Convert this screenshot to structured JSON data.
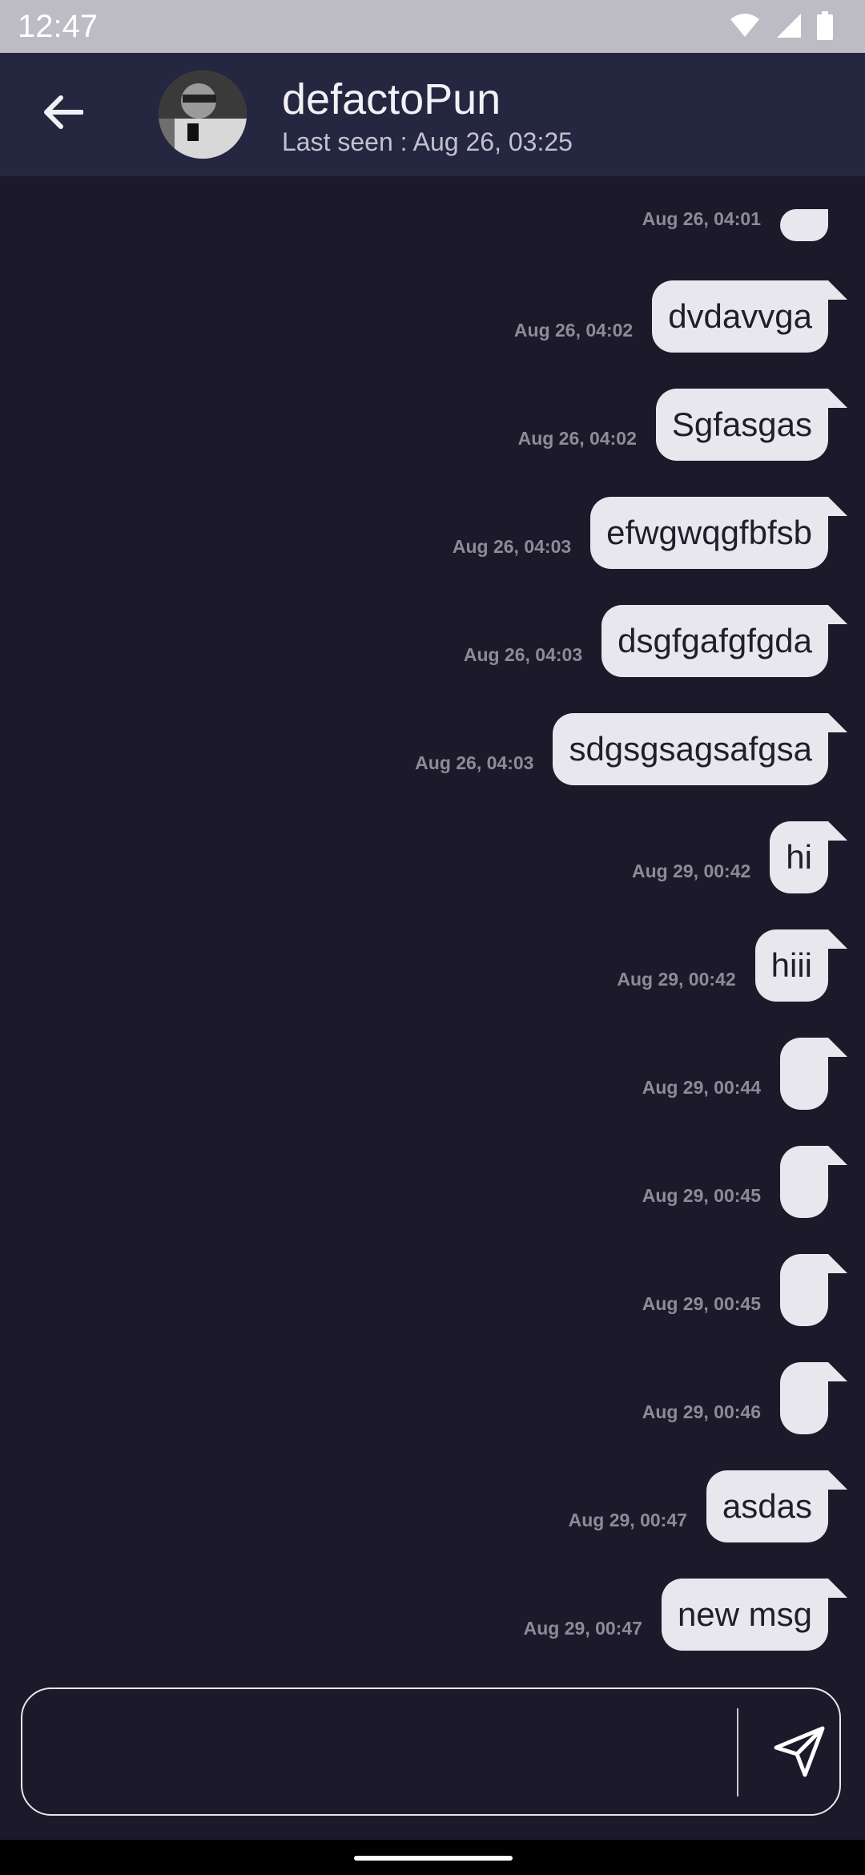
{
  "status_bar": {
    "time": "12:47",
    "icons": [
      "wifi-icon",
      "signal-icon",
      "battery-icon"
    ]
  },
  "header": {
    "contact_name": "defactoPun",
    "last_seen": "Last seen : Aug 26, 03:25",
    "avatar_alt": "avatar",
    "colors": {
      "header_bg": "#252640"
    }
  },
  "messages": [
    {
      "text": "",
      "time": "Aug 26, 04:01"
    },
    {
      "text": "dvdavvga",
      "time": "Aug 26, 04:02"
    },
    {
      "text": "Sgfasgas",
      "time": "Aug 26, 04:02"
    },
    {
      "text": "efwgwqgfbfsb",
      "time": "Aug 26, 04:03"
    },
    {
      "text": "dsgfgafgfgda",
      "time": "Aug 26, 04:03"
    },
    {
      "text": "sdgsgsagsafgsa",
      "time": "Aug 26, 04:03"
    },
    {
      "text": "hi",
      "time": "Aug 29, 00:42"
    },
    {
      "text": "hiii",
      "time": "Aug 29, 00:42"
    },
    {
      "text": "",
      "time": "Aug 29, 00:44"
    },
    {
      "text": "",
      "time": "Aug 29, 00:45"
    },
    {
      "text": "",
      "time": "Aug 29, 00:45"
    },
    {
      "text": "",
      "time": "Aug 29, 00:46"
    },
    {
      "text": "asdas",
      "time": "Aug 29, 00:47"
    },
    {
      "text": "new msg",
      "time": "Aug 29, 00:47"
    }
  ],
  "composer": {
    "value": "",
    "placeholder": ""
  },
  "colors": {
    "background": "#1c1a2a",
    "bubble": "#e8e7ee",
    "timestamp": "#8c8b99"
  }
}
